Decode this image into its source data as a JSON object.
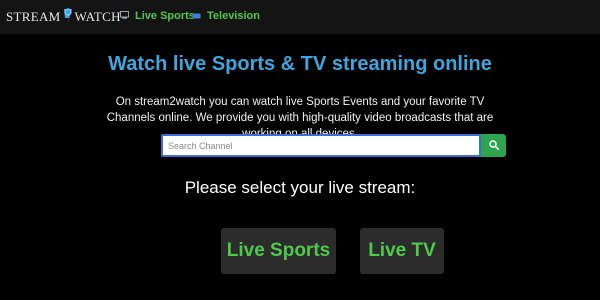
{
  "brand": {
    "logo_left": "STREAM",
    "logo_right": "WATCH"
  },
  "nav": {
    "items": [
      {
        "label": "Live Sports",
        "icon": "tv-monitor-icon"
      },
      {
        "label": "Television",
        "icon": "tv-icon"
      }
    ]
  },
  "hero": {
    "title": "Watch live Sports & TV streaming online",
    "description": "On stream2watch you can watch live Sports Events and your favorite TV Channels online. We provide you with high-quality video broadcasts that are working on all devices."
  },
  "search": {
    "placeholder": "Search Channel",
    "value": "",
    "button_icon": "search-icon"
  },
  "streams": {
    "heading": "Please select your live stream:",
    "buttons": [
      {
        "label": "Live Sports"
      },
      {
        "label": "Live TV"
      }
    ]
  },
  "colors": {
    "background": "#000000",
    "navbar": "#141414",
    "accent_green": "#4ec94a",
    "title_blue": "#3ea6dc",
    "search_button": "#2ea44f",
    "search_border": "#3b6fd6",
    "stream_button_bg": "#2c2c2c"
  }
}
